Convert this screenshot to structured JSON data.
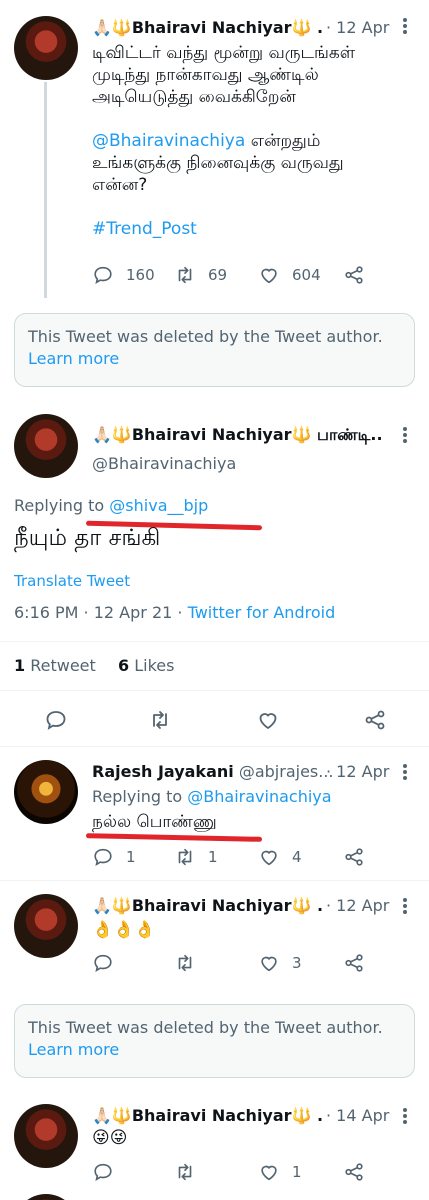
{
  "tweets": [
    {
      "name": "🙏🏻🔱Bhairavi Nachiyar🔱 ...",
      "date": "· 12 Apr",
      "text_lines": [
        "டிவிட்டர் வந்து மூன்று வருடங்கள்",
        "முடிந்து நான்காவது ஆண்டில்",
        "அடியெடுத்து வைக்கிறேன்"
      ],
      "mention": "@Bhairavinachiya",
      "mention_rest": " என்றதும்",
      "text_lines2": [
        "உங்களுக்கு நினைவுக்கு வருவது",
        "என்ன?"
      ],
      "hashtag": "#Trend_Post",
      "replies": "160",
      "retweets": "69",
      "likes": "604"
    }
  ],
  "deleted_1": {
    "text": "This Tweet was deleted by the Tweet author.",
    "link": "Learn more"
  },
  "main_tweet": {
    "name": "🙏🏻🔱Bhairavi Nachiyar🔱 பாண்டி...",
    "handle": "@Bhairavinachiya",
    "replying_prefix": "Replying to ",
    "replying_to": "@shiva__bjp",
    "text": "நீயும் தா சங்கி",
    "translate": "Translate Tweet",
    "time": "6:16 PM · 12 Apr 21 · ",
    "source": "Twitter for Android",
    "retweet_count": "1",
    "retweet_label": " Retweet",
    "like_count": "6",
    "like_label": " Likes"
  },
  "reply_1": {
    "name": "Rajesh Jayakani",
    "handle": "@abjrajes...",
    "date": "· 12 Apr",
    "replying_prefix": "Replying to ",
    "replying_to": "@Bhairavinachiya",
    "text": "நல்ல பொண்ணு",
    "replies": "1",
    "retweets": "1",
    "likes": "4"
  },
  "reply_2": {
    "name": "🙏🏻🔱Bhairavi Nachiyar🔱 ...",
    "date": "· 12 Apr",
    "text": "👌👌👌",
    "likes": "3"
  },
  "deleted_2": {
    "text": "This Tweet was deleted by the Tweet author.",
    "link": "Learn more"
  },
  "reply_3": {
    "name": "🙏🏻🔱Bhairavi Nachiyar🔱 ...",
    "date": "· 14 Apr",
    "text": "😜😜",
    "likes": "1"
  },
  "colors": {
    "accent": "#1d9bf0",
    "muted": "#536471",
    "annotation": "#e0262b"
  }
}
